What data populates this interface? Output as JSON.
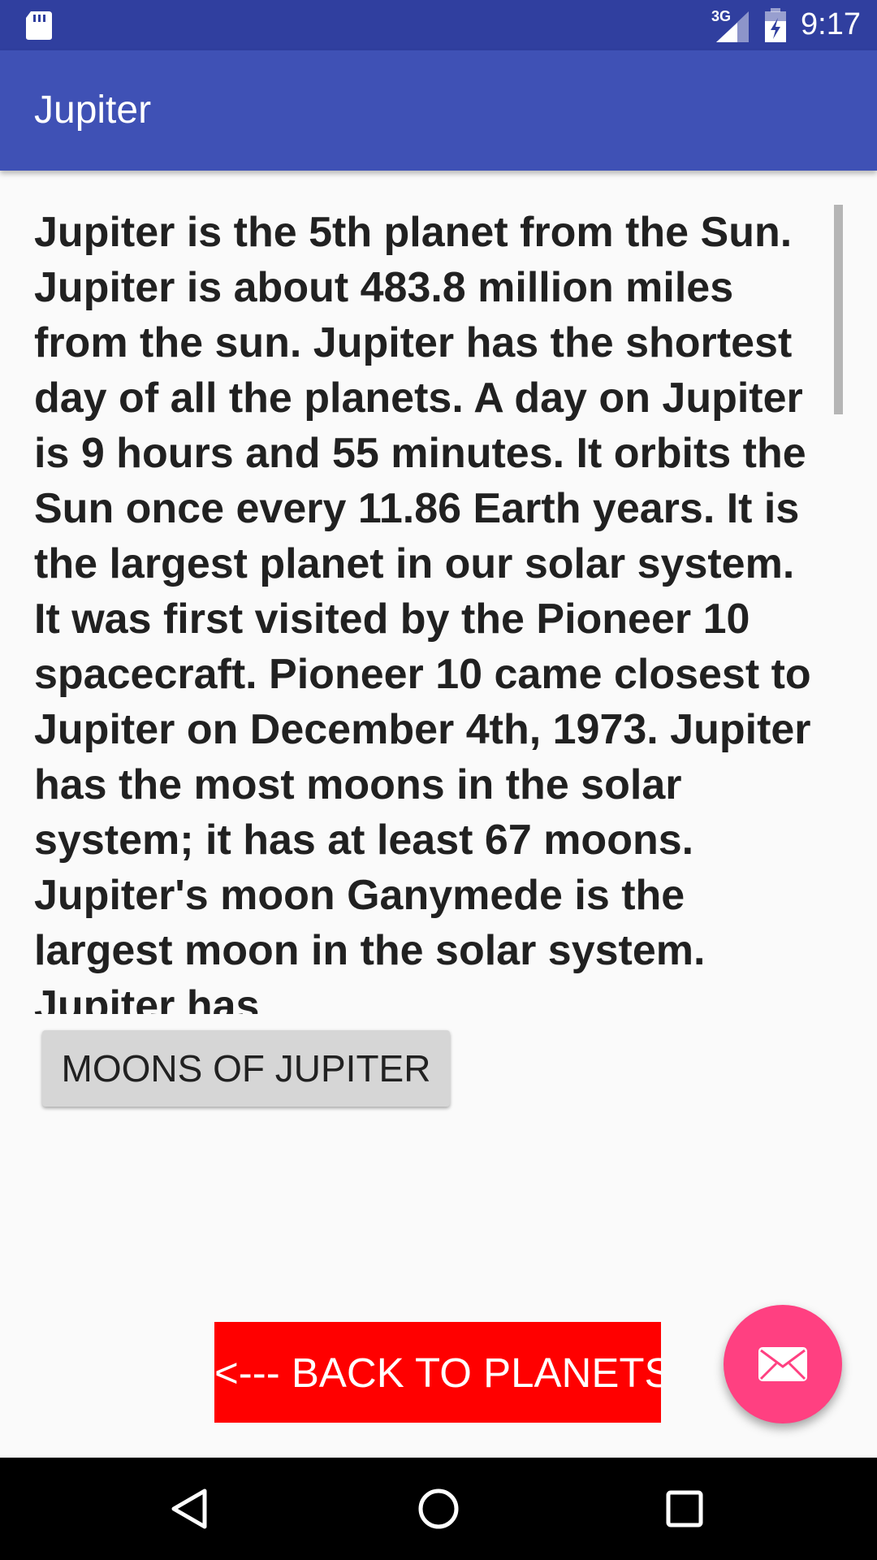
{
  "status_bar": {
    "time": "9:17",
    "network": "3G",
    "icons": [
      "sd-card-icon",
      "signal-icon",
      "battery-charging-icon"
    ]
  },
  "app_bar": {
    "title": "Jupiter"
  },
  "content": {
    "text": "Jupiter is the 5th planet from the Sun. Jupiter is about 483.8 million miles from the sun. Jupiter has the shortest day of all the planets. A day on Jupiter is 9 hours and 55 minutes. It orbits the Sun once every 11.86 Earth years. It is the largest planet in our solar system. It was first visited by the Pioneer 10 spacecraft. Pioneer 10 came closest to Jupiter on December 4th, 1973. Jupiter has the most moons in the solar system; it has at least 67 moons. Jupiter's moon Ganymede is the largest moon in the solar system. Jupiter has"
  },
  "buttons": {
    "moons_label": "MOONS OF JUPITER",
    "back_label": "<--- BACK TO PLANETS"
  },
  "fab": {
    "icon": "email-icon"
  },
  "navigation": {
    "icons": [
      "nav-back-icon",
      "nav-home-icon",
      "nav-recents-icon"
    ]
  },
  "colors": {
    "status_bar": "#303f9f",
    "app_bar": "#3f51b5",
    "back_button": "#ff0000",
    "fab": "#ff4081",
    "moons_button": "#d6d6d6"
  }
}
